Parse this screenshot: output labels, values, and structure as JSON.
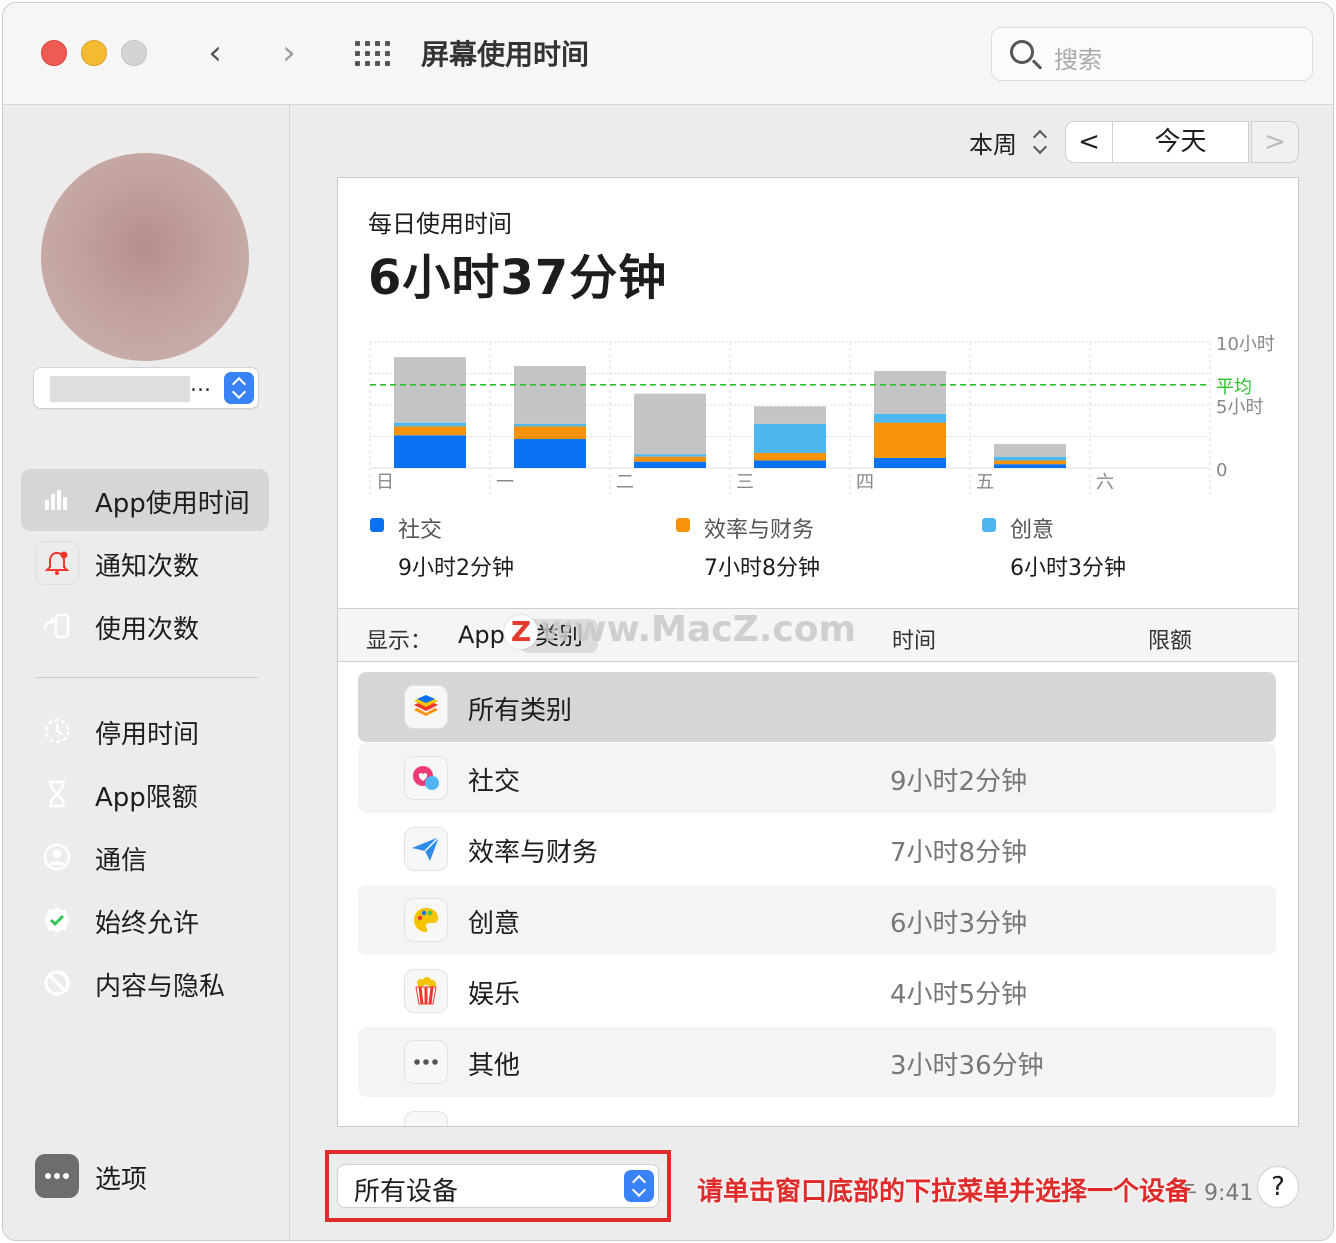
{
  "window": {
    "title": "屏幕使用时间",
    "search_placeholder": "搜索"
  },
  "sidebar": {
    "user_name_suffix": "...",
    "items": [
      {
        "label": "App使用时间",
        "icon": "bar-chart-icon",
        "color": "#1a7af8",
        "active": true
      },
      {
        "label": "通知次数",
        "icon": "bell-icon",
        "color": "#f0f0f0",
        "active": false
      },
      {
        "label": "使用次数",
        "icon": "pickup-icon",
        "color": "#f5c400",
        "active": false
      },
      {
        "label": "停用时间",
        "icon": "downtime-icon",
        "color": "#6b5cf0",
        "active": false
      },
      {
        "label": "App限额",
        "icon": "hourglass-icon",
        "color": "#f3911a",
        "active": false
      },
      {
        "label": "通信",
        "icon": "contact-icon",
        "color": "#35c759",
        "active": false
      },
      {
        "label": "始终允许",
        "icon": "check-badge-icon",
        "color": "#35c759",
        "active": false
      },
      {
        "label": "内容与隐私",
        "icon": "restriction-icon",
        "color": "#f2362e",
        "active": false
      }
    ],
    "options_label": "选项"
  },
  "header": {
    "range_label": "本周",
    "prev_symbol": "<",
    "today_label": "今天",
    "next_symbol": ">"
  },
  "summary": {
    "subtitle": "每日使用时间",
    "total": "6小时37分钟"
  },
  "chart_data": {
    "type": "bar",
    "stacked": true,
    "categories": [
      "日",
      "一",
      "二",
      "三",
      "四",
      "五",
      "六"
    ],
    "series": [
      {
        "name": "社交",
        "color": "#0a72f2",
        "values": [
          2.6,
          2.3,
          0.5,
          0.6,
          0.8,
          0.3,
          0
        ]
      },
      {
        "name": "效率与财务",
        "color": "#f7930a",
        "values": [
          0.7,
          1.0,
          0.4,
          0.6,
          2.8,
          0.3,
          0
        ]
      },
      {
        "name": "创意",
        "color": "#4fb7ef",
        "values": [
          0.3,
          0.2,
          0.2,
          2.3,
          0.7,
          0.3,
          0
        ]
      },
      {
        "name": "其他",
        "color": "#c4c4c4",
        "values": [
          5.2,
          4.6,
          4.8,
          1.4,
          3.4,
          1.0,
          0
        ]
      }
    ],
    "ylim": [
      0,
      10
    ],
    "yticks": [
      {
        "value": 10,
        "label": "10小时"
      },
      {
        "value": 5,
        "label": "5小时"
      },
      {
        "value": 0,
        "label": "0"
      }
    ],
    "average": {
      "value": 6.6,
      "label": "平均"
    },
    "colors": {
      "grid": "#dedede",
      "average": "#2cbf2c",
      "axis_text": "#888888"
    }
  },
  "legend": [
    {
      "name": "社交",
      "value": "9小时2分钟",
      "color": "#0a72f2"
    },
    {
      "name": "效率与财务",
      "value": "7小时8分钟",
      "color": "#f7930a"
    },
    {
      "name": "创意",
      "value": "6小时3分钟",
      "color": "#4fb7ef"
    }
  ],
  "list": {
    "show_label": "显示：",
    "show_app": "App",
    "show_category": "类别",
    "col_time": "时间",
    "col_limit": "限额",
    "watermark": "www.MacZ.com",
    "watermark_mark": "Z",
    "rows": [
      {
        "name": "所有类别",
        "time": "",
        "icon": "layers-icon"
      },
      {
        "name": "社交",
        "time": "9小时2分钟",
        "icon": "chat-heart-icon"
      },
      {
        "name": "效率与财务",
        "time": "7小时8分钟",
        "icon": "paper-plane-icon"
      },
      {
        "name": "创意",
        "time": "6小时3分钟",
        "icon": "palette-icon"
      },
      {
        "name": "娱乐",
        "time": "4小时5分钟",
        "icon": "popcorn-icon"
      },
      {
        "name": "其他",
        "time": "3小时36分钟",
        "icon": "ellipsis-icon"
      }
    ]
  },
  "footer": {
    "device_label": "所有设备",
    "hint": "请单击窗口底部的下拉菜单并选择一个设备",
    "update_time": "午 9:41",
    "help_label": "?"
  },
  "colors": {
    "accent": "#3a82f7",
    "highlight_red": "#e02b2b"
  }
}
